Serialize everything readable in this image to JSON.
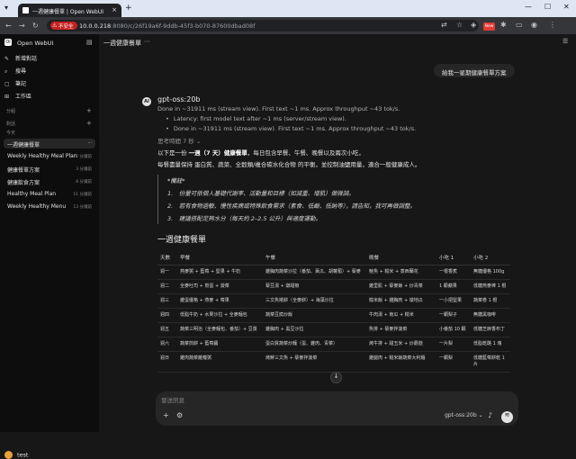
{
  "browser": {
    "tab_title": "一週健康餐單 | Open WebUI",
    "new_tab_symbol": "+",
    "security_label": "不安全",
    "url_host": "10.0.0.218",
    "url_path": ":8080/c/26f19a6f-9ddb-45f3-b070-87600dbad08f",
    "new_badge": "New"
  },
  "sidebar": {
    "app_name": "Open WebUI",
    "nav": [
      {
        "label": "新增對話",
        "icon": "edit-icon"
      },
      {
        "label": "搜尋",
        "icon": "search-icon"
      },
      {
        "label": "筆記",
        "icon": "note-icon"
      },
      {
        "label": "工作區",
        "icon": "workspace-icon"
      }
    ],
    "section_groups": "分組",
    "section_chats": "對話",
    "section_today": "今天",
    "chats": [
      {
        "title": "一週健康餐單",
        "meta": ""
      },
      {
        "title": "Weekly Healthy Meal Plan",
        "meta": "2 分鐘前"
      },
      {
        "title": "健康餐單方案",
        "meta": "3 分鐘前"
      },
      {
        "title": "健康飲食方案",
        "meta": "8 分鐘前"
      },
      {
        "title": "Healthy Meal Plan",
        "meta": "11 分鐘前"
      },
      {
        "title": "Weekly Healthy Menu",
        "meta": "13 分鐘前"
      }
    ],
    "user": "test"
  },
  "chat": {
    "title": "一週健康餐單",
    "user_message": "給我一星期健康餐單方案",
    "model": "gpt-oss:20b",
    "stat_main": "Done in ~31911 ms (stream view). First text ~1 ms. Approx throughput ~43 tok/s.",
    "stat_bullets": [
      "Latency: first model text after ~1 ms (server/stream view).",
      "Done in ~31911 ms (stream view). First text ~1 ms. Approx throughput ~43 tok/s."
    ],
    "thinking": "思考時間 7 秒",
    "intro_1a": "以下是一份 ",
    "intro_1b": "一週（7 天）健康餐單",
    "intro_1c": "，每日包含早餐、午餐、晚餐以及兩次小吃，",
    "intro_2": "每餐盡量保持 蛋白質、蔬菜、全穀類/複合碳水化合物 的平衡，並控制油鹽用量，適合一般健康成人。",
    "note_title": "*備註*",
    "notes": [
      "1.　份量可依個人基礎代謝率、活動量和目標（如減重、增肌）做微調。",
      "2.　若有食物過敏、慢性疾病或特殊飲食需求（素食、低鹼、低鈉等），請告知，我可再做調整。",
      "3.　建議搭配足夠水分（每天約 2–2.5 公升）與適度運動。"
    ],
    "section_heading": "一週健康餐單",
    "table": {
      "headers": [
        "天數",
        "早餐",
        "午餐",
        "晚餐",
        "小吃 1",
        "小吃 2"
      ],
      "rows": [
        [
          "週一",
          "燕麥粥 + 藍莓 + 堅果 + 牛奶",
          "雞胸肉蔬菜沙拉（番茄、黃瓜、胡蘿蔔）+ 藜麥",
          "鮭魚 + 糙米 + 蒸西蘭花",
          "一根香蕉",
          "無糖優格 100g"
        ],
        [
          "週二",
          "全麥吐司 + 煎蛋 + 菠菜",
          "藜豆湯 + 燉甜椒",
          "雞里肌 + 藜麥飯 + 炒青菜",
          "1 顆蘋果",
          "低糖燕麥棒 1 根"
        ],
        [
          "週三",
          "雞蛋優格 + 燕麥 + 莓果",
          "三文魚捲餅（全麥餅）+ 海藻沙拉",
          "糙米飯 + 雞胸肉 + 燉地瓜",
          "一小把堅果",
          "蔬菜卷 1 根"
        ],
        [
          "週四",
          "低脂牛奶 + 水果沙拉 + 全麥麵包",
          "蔬菜豆腐炒飯",
          "牛肉湯 + 南瓜 + 糙米",
          "一顆梨子",
          "無糖黑咖啡"
        ],
        [
          "週五",
          "蔬菜三明治（全麥麵包、番茄）+ 豆漿",
          "雞胸肉 + 黑豆沙拉",
          "魚排 + 藜麥拌菠菜",
          "小番茄 10 顆",
          "低糖芝麻香布丁"
        ],
        [
          "週六",
          "蔬菜煎餅 + 藍莓醬",
          "蛋白質蔬菜炒麵（蛋、雞肉、青菜）",
          "烤牛排 + 甜玉米 + 炒蘑菇",
          "一片梨",
          "低脂乾酪 1 塊"
        ],
        [
          "週日",
          "雞肉蔬菜雜糧粥",
          "烤鮮三文魚 + 藜麥拌菠菜",
          "雞腿肉 + 糙米飯蔬菜大利麵",
          "一顆梨",
          "低糖藍莓餅乾 1 片"
        ]
      ]
    },
    "scroll_down_symbol": "↓",
    "input_placeholder": "發送訊息",
    "model_selector": "gpt-oss:20b"
  }
}
